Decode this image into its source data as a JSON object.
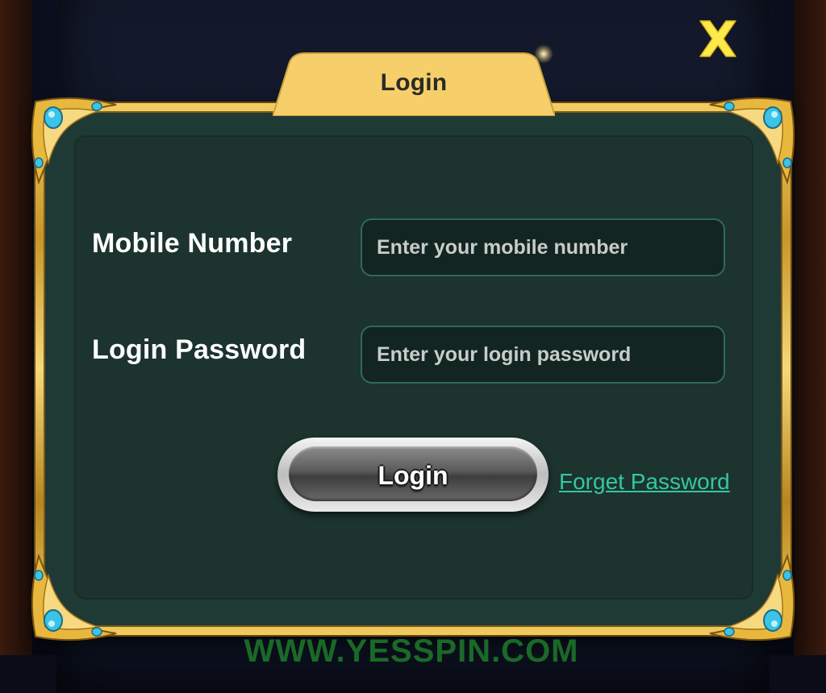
{
  "dialog": {
    "tab_title": "Login"
  },
  "form": {
    "mobile_label": "Mobile Number",
    "mobile_placeholder": "Enter your mobile number",
    "password_label": "Login Password",
    "password_placeholder": "Enter your login password"
  },
  "actions": {
    "login_label": "Login",
    "forget_label": "Forget Password"
  },
  "watermark": "WWW.YESSPIN.COM",
  "colors": {
    "panel": "#1c332e",
    "gold": "#f3cd63",
    "link": "#35c6a4",
    "close_icon": "#fcea4a"
  }
}
